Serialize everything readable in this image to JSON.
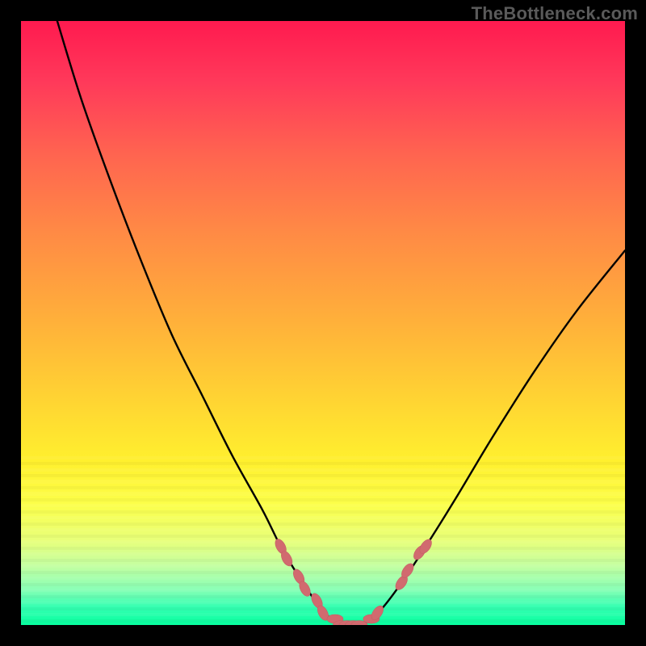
{
  "watermark": "TheBottleneck.com",
  "colors": {
    "frame": "#000000",
    "curve_stroke": "#000000",
    "marker_fill": "#d16a6f",
    "marker_stroke": "#c65f64",
    "gradient_stops": [
      "#ff1a4f",
      "#ff395a",
      "#ff6450",
      "#ff8a45",
      "#ffb13a",
      "#ffd233",
      "#fff02e",
      "#fcff4a",
      "#e8ff7a",
      "#c6ffa0",
      "#8bffb5",
      "#36ffb2",
      "#07ff9f"
    ]
  },
  "chart_data": {
    "type": "line",
    "title": "",
    "xlabel": "",
    "ylabel": "",
    "xlim": [
      0,
      100
    ],
    "ylim": [
      0,
      100
    ],
    "grid": false,
    "legend": false,
    "series": [
      {
        "name": "bottleneck-curve",
        "x": [
          6,
          10,
          15,
          20,
          25,
          30,
          35,
          40,
          43,
          46,
          48,
          50,
          52,
          54,
          56,
          58,
          60,
          63,
          67,
          72,
          78,
          85,
          92,
          100
        ],
        "y": [
          100,
          87,
          73,
          60,
          48,
          38,
          28,
          19,
          13,
          8,
          5,
          2,
          1,
          0,
          0,
          1,
          3,
          7,
          13,
          21,
          31,
          42,
          52,
          62
        ]
      }
    ],
    "markers": {
      "name": "highlighted-segments",
      "x": [
        43,
        44,
        46,
        47,
        49,
        50,
        52,
        53,
        54,
        55,
        56,
        58,
        59,
        63,
        64,
        66,
        67
      ],
      "y": [
        13,
        11,
        8,
        6,
        4,
        2,
        1,
        0,
        0,
        0,
        0,
        1,
        2,
        7,
        9,
        12,
        13
      ]
    },
    "bottom_bands": {
      "start_y_pct": 72,
      "count": 28,
      "note": "thin horizontal bands visually separating lower gradient region"
    }
  }
}
